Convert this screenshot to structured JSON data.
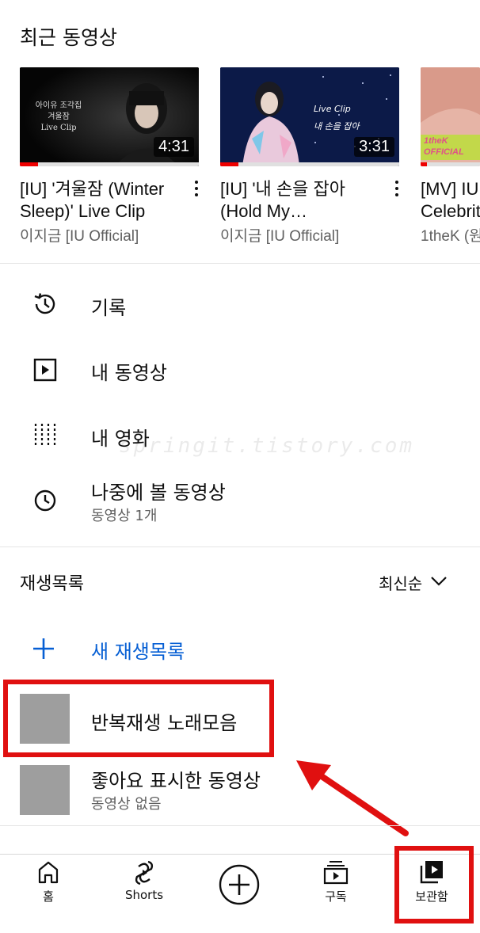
{
  "recent": {
    "title": "최근 동영상",
    "videos": [
      {
        "title": "[IU] '겨울잠 (Winter Sleep)' Live Clip",
        "channel": "이지금 [IU Official]",
        "duration": "4:31",
        "thumb_text": "아이유 조각집\n겨울잠\nLive Clip"
      },
      {
        "title": "[IU] '내 손을 잡아(Hold My…",
        "channel": "이지금 [IU Official]",
        "duration": "3:31",
        "thumb_text": "Live Clip\n내 손을 잡아"
      },
      {
        "title": "[MV] IU Celebrit",
        "channel": "1theK (원",
        "duration": "",
        "thumb_text": "1theK\nOFFICIAL"
      }
    ]
  },
  "library_menu": [
    {
      "label": "기록",
      "icon": "history-icon"
    },
    {
      "label": "내 동영상",
      "icon": "play-square-icon"
    },
    {
      "label": "내 영화",
      "icon": "film-icon"
    },
    {
      "label": "나중에 볼 동영상",
      "sublabel": "동영상 1개",
      "icon": "clock-icon"
    }
  ],
  "watermark": "springit.tistory.com",
  "playlists": {
    "title": "재생목록",
    "sort_label": "최신순",
    "new_playlist_label": "새 재생목록",
    "items": [
      {
        "label": "반복재생 노래모음"
      },
      {
        "label": "좋아요 표시한 동영상",
        "sublabel": "동영상 없음"
      }
    ]
  },
  "bottom_nav": [
    {
      "label": "홈",
      "icon": "home-icon"
    },
    {
      "label": "Shorts",
      "icon": "shorts-icon"
    },
    {
      "label": "",
      "icon": "create-plus-icon"
    },
    {
      "label": "구독",
      "icon": "subscriptions-icon"
    },
    {
      "label": "보관함",
      "icon": "library-icon"
    }
  ],
  "colors": {
    "accent_blue": "#065fd4",
    "annotation_red": "#e01010",
    "progress_red": "#ee0000"
  }
}
